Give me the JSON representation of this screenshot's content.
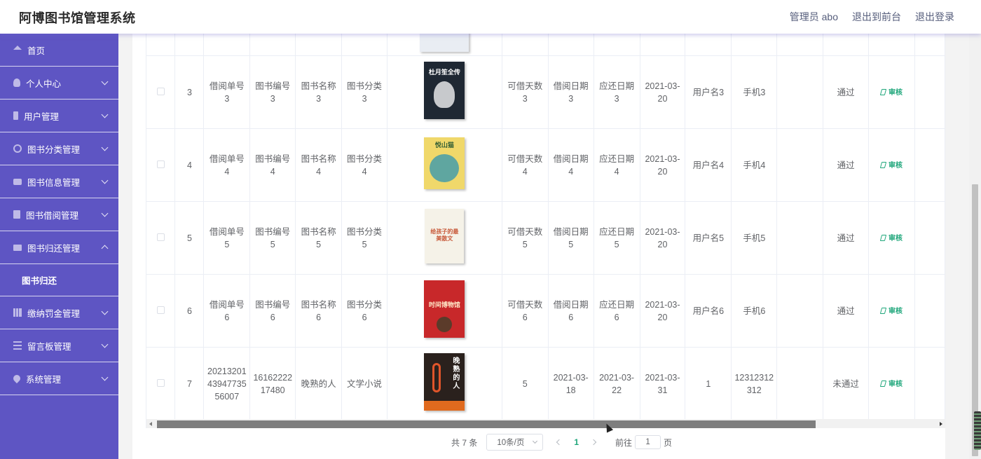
{
  "app": {
    "title": "阿博图书馆管理系统"
  },
  "header": {
    "admin": "管理员 abo",
    "to_front": "退出到前台",
    "logout": "退出登录"
  },
  "sidebar": {
    "items": [
      {
        "label": "首页",
        "icon": "home-icon"
      },
      {
        "label": "个人中心",
        "icon": "user-icon"
      },
      {
        "label": "用户管理",
        "icon": "phone-icon"
      },
      {
        "label": "图书分类管理",
        "icon": "circle-icon"
      },
      {
        "label": "图书信息管理",
        "icon": "bag-icon"
      },
      {
        "label": "图书借阅管理",
        "icon": "document-icon"
      },
      {
        "label": "图书归还管理",
        "icon": "monitor-icon"
      },
      {
        "label": "缴纳罚金管理",
        "icon": "bar-chart-icon"
      },
      {
        "label": "留言板管理",
        "icon": "list-icon"
      },
      {
        "label": "系统管理",
        "icon": "drop-icon"
      }
    ],
    "submenu": {
      "label": "图书归还"
    }
  },
  "table": {
    "audit_label": "审核",
    "rows": [
      {
        "idx": "3",
        "borrow_no": "借阅单号3",
        "book_no": "图书编号3",
        "book_name": "图书名称3",
        "category": "图书分类3",
        "days": "可借天数3",
        "borrow_date": "借阅日期3",
        "due_date": "应还日期3",
        "return_date": "2021-03-20",
        "username": "用户名3",
        "phone": "手机3",
        "status": "通过"
      },
      {
        "idx": "4",
        "borrow_no": "借阅单号4",
        "book_no": "图书编号4",
        "book_name": "图书名称4",
        "category": "图书分类4",
        "days": "可借天数4",
        "borrow_date": "借阅日期4",
        "due_date": "应还日期4",
        "return_date": "2021-03-20",
        "username": "用户名4",
        "phone": "手机4",
        "status": "通过"
      },
      {
        "idx": "5",
        "borrow_no": "借阅单号5",
        "book_no": "图书编号5",
        "book_name": "图书名称5",
        "category": "图书分类5",
        "days": "可借天数5",
        "borrow_date": "借阅日期5",
        "due_date": "应还日期5",
        "return_date": "2021-03-20",
        "username": "用户名5",
        "phone": "手机5",
        "status": "通过"
      },
      {
        "idx": "6",
        "borrow_no": "借阅单号6",
        "book_no": "图书编号6",
        "book_name": "图书名称6",
        "category": "图书分类6",
        "days": "可借天数6",
        "borrow_date": "借阅日期6",
        "due_date": "应还日期6",
        "return_date": "2021-03-20",
        "username": "用户名6",
        "phone": "手机6",
        "status": "通过"
      },
      {
        "idx": "7",
        "borrow_no": "202132014394773556007",
        "book_no": "1616222217480",
        "book_name": "晚熟的人",
        "category": "文学小说",
        "days": "5",
        "borrow_date": "2021-03-18",
        "due_date": "2021-03-22",
        "return_date": "2021-03-31",
        "username": "1",
        "phone": "12312312312",
        "status": "未通过"
      }
    ],
    "covers": [
      {
        "title": "杜月笙全传",
        "bg": "#1f2833",
        "fg": "#ffffff"
      },
      {
        "title": "悦山猫",
        "bg": "#f0d86a",
        "fg": "#2f5d34"
      },
      {
        "title": "给孩子的最美散文",
        "bg": "#f5f2e8",
        "fg": "#c85a3a"
      },
      {
        "title": "时间博物馆",
        "bg": "#c8282a",
        "fg": "#ffe9c9"
      },
      {
        "title": "晚熟的人",
        "bg": "#2a211d",
        "fg": "#ffffff"
      }
    ]
  },
  "pagination": {
    "total": "共 7 条",
    "page_size": "10条/页",
    "current": "1",
    "goto_label": "前往",
    "goto_value": "1",
    "page_suffix": "页"
  },
  "colors": {
    "sidebar_bg": "#5e55c3",
    "accent_green": "#1ea67a"
  }
}
